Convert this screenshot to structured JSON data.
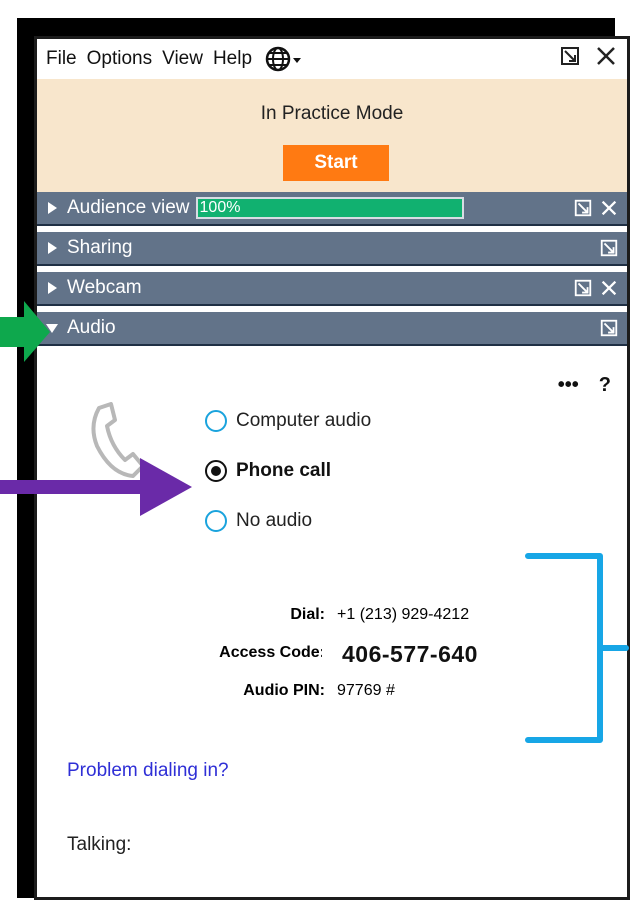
{
  "menubar": {
    "items": [
      "File",
      "Options",
      "View",
      "Help"
    ]
  },
  "practice": {
    "mode_text": "In Practice Mode",
    "start_label": "Start"
  },
  "sections": {
    "audience_view": {
      "label": "Audience view",
      "meter_text": "100%",
      "meter_level": 1.0
    },
    "sharing": {
      "label": "Sharing"
    },
    "webcam": {
      "label": "Webcam"
    },
    "audio": {
      "label": "Audio"
    }
  },
  "audio": {
    "more_label": "•••",
    "help_label": "?",
    "options": [
      {
        "label": "Computer audio",
        "selected": false
      },
      {
        "label": "Phone call",
        "selected": true
      },
      {
        "label": "No audio",
        "selected": false
      }
    ],
    "dial_label": "Dial:",
    "dial_value": "+1 (213) 929-4212",
    "access_label": "Access Code:",
    "access_value": "406-577-640",
    "pin_label": "Audio PIN:",
    "pin_value": "97769 #",
    "problem_link": "Problem dialing in?",
    "talking_label": "Talking:"
  },
  "colors": {
    "practice_bg": "#f8e6cc",
    "start_button": "#ff7a12",
    "section_bar": "#627389",
    "meter": "#11b170",
    "link": "#2f2fd6",
    "arrow_green": "#0ea84d",
    "arrow_purple": "#6a2aa8",
    "bracket_blue": "#17a6e6"
  }
}
